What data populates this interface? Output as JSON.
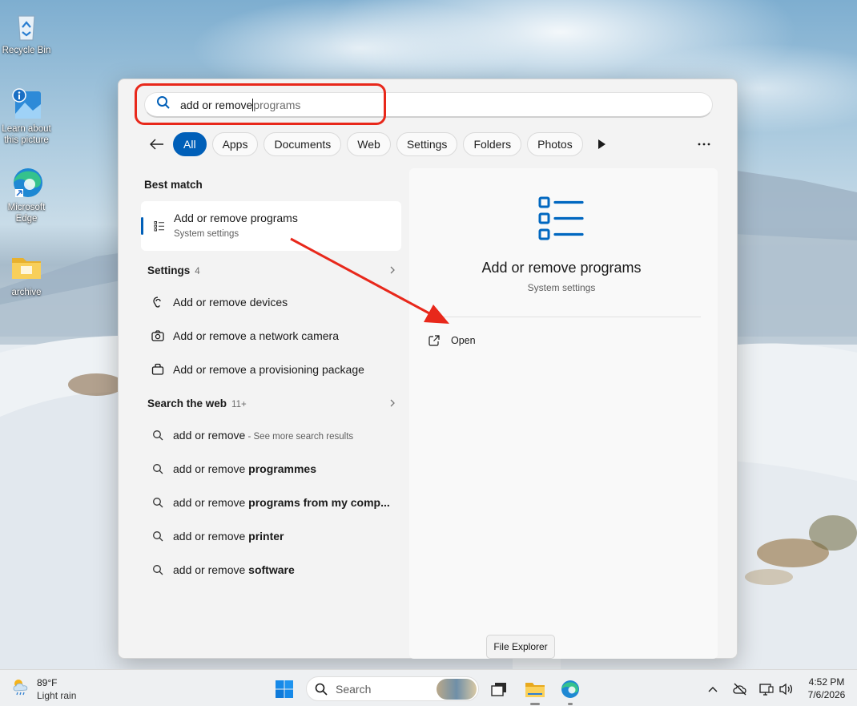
{
  "desktop": {
    "icons": [
      {
        "label": "Recycle Bin",
        "icon": "recycle-bin-icon"
      },
      {
        "label": "Learn about this picture",
        "icon": "info-picture-icon"
      },
      {
        "label": "Microsoft Edge",
        "icon": "edge-icon"
      },
      {
        "label": "archive",
        "icon": "folder-icon"
      }
    ]
  },
  "search": {
    "typed": "add or remove",
    "suggestion": "programs"
  },
  "filters": {
    "tabs": [
      "All",
      "Apps",
      "Documents",
      "Web",
      "Settings",
      "Folders",
      "Photos"
    ],
    "active": "All"
  },
  "results": {
    "best_match_heading": "Best match",
    "best_match": {
      "title": "Add or remove programs",
      "subtitle": "System settings"
    },
    "settings_heading": "Settings",
    "settings_count": "4",
    "settings_items": [
      {
        "label": "Add or remove devices",
        "icon": "bluetooth-headset-icon"
      },
      {
        "label": "Add or remove a network camera",
        "icon": "camera-icon"
      },
      {
        "label": "Add or remove a provisioning package",
        "icon": "package-icon"
      }
    ],
    "web_heading": "Search the web",
    "web_count": "11+",
    "web_items": [
      {
        "plain": "add or remove",
        "bold": "",
        "note": " - See more search results"
      },
      {
        "plain": "add or remove ",
        "bold": "programmes",
        "note": ""
      },
      {
        "plain": "add or remove ",
        "bold": "programs from my comp...",
        "note": ""
      },
      {
        "plain": "add or remove ",
        "bold": "printer",
        "note": ""
      },
      {
        "plain": "add or remove ",
        "bold": "software",
        "note": ""
      }
    ]
  },
  "preview": {
    "title": "Add or remove programs",
    "subtitle": "System settings",
    "open_label": "Open"
  },
  "tooltip": "File Explorer",
  "taskbar": {
    "temperature": "89°F",
    "condition": "Light rain",
    "search_placeholder": "Search",
    "time": "4:52 PM",
    "date": "7/6/2026"
  },
  "colors": {
    "accent": "#005fb8",
    "annotation_red": "#e8281b"
  }
}
